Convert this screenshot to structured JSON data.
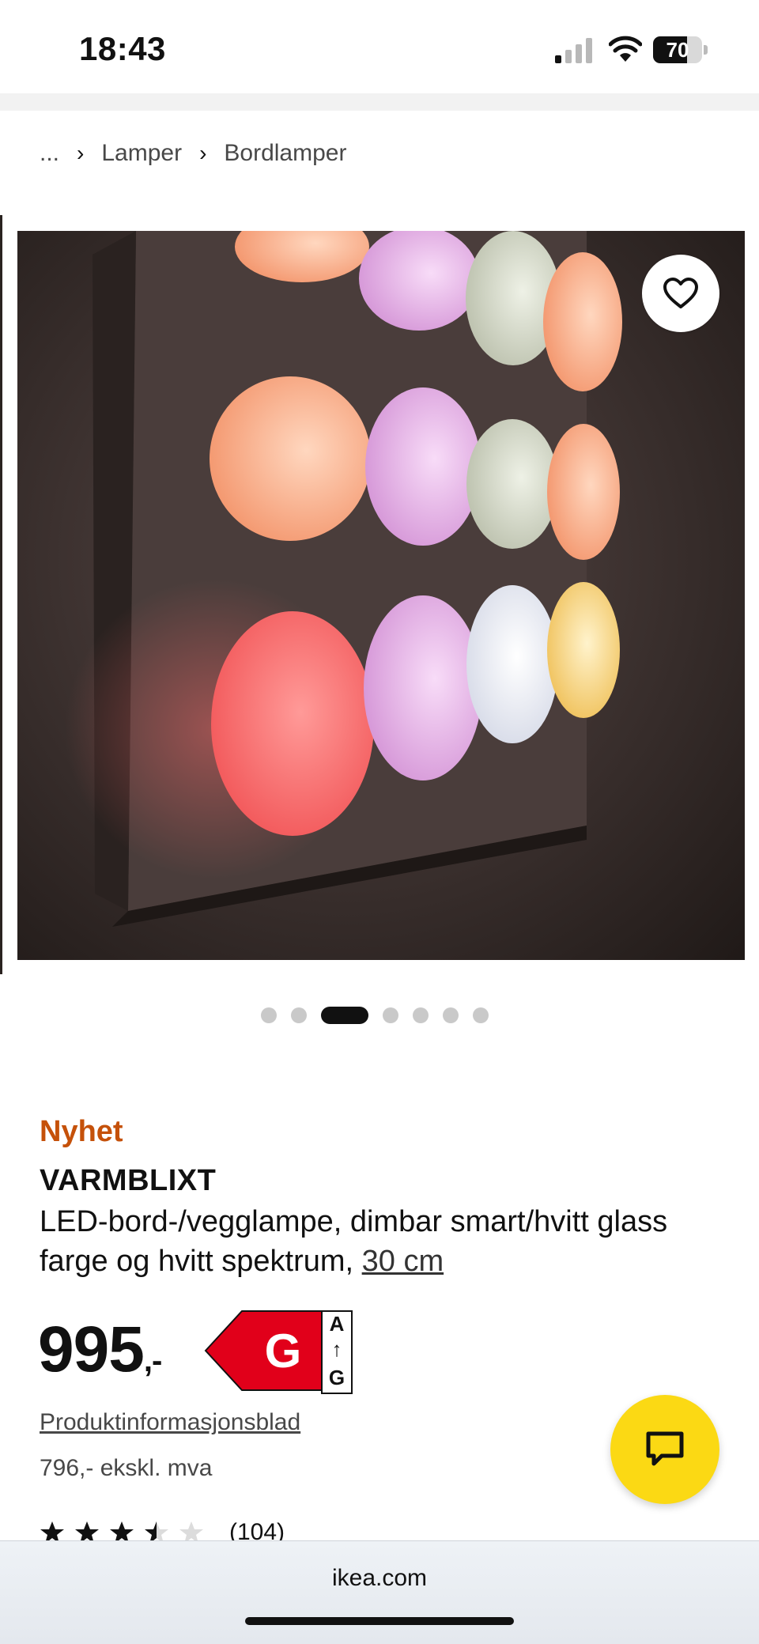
{
  "status_bar": {
    "time": "18:43",
    "battery": "70",
    "battery_level": 0.7
  },
  "breadcrumb": {
    "ellipsis": "...",
    "items": [
      "Lamper",
      "Bordlamper"
    ]
  },
  "gallery": {
    "dot_count": 7,
    "active_index": 2
  },
  "product": {
    "badge": "Nyhet",
    "name": "VARMBLIXT",
    "description": "LED-bord-/vegglampe, dimbar smart/hvitt glass farge og hvitt spektrum,",
    "size": "30 cm",
    "price": "995",
    "price_suffix": ",-",
    "energy_class": "G",
    "energy_scale_top": "A",
    "energy_scale_bottom": "G",
    "info_sheet": "Produktinformasjonsblad",
    "price_ex_vat": "796,- ekskl. mva",
    "rating": 3.5,
    "review_count": "(104)"
  },
  "browser": {
    "url": "ikea.com"
  },
  "icons": {
    "favorite": "heart-icon",
    "chat": "chat-icon",
    "breadcrumb_separator": "chevron-right-icon"
  },
  "colors": {
    "badge": "#c5510a",
    "chat_button": "#fbd914",
    "energy_label": "#e1001a"
  }
}
